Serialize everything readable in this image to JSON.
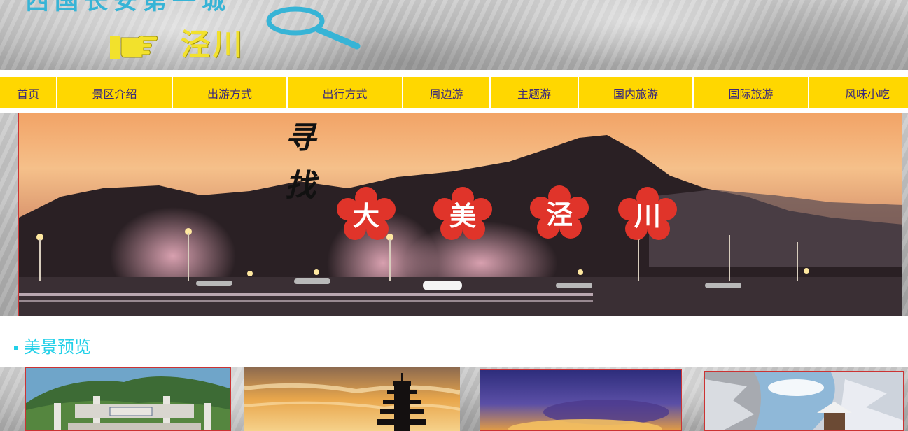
{
  "header": {
    "title": "西国长安第一城",
    "city": "泾川",
    "hand_icon": "pointing-hand-icon",
    "magnifier_icon": "magnifier-icon"
  },
  "nav": {
    "items": [
      {
        "label": "首页"
      },
      {
        "label": "景区介绍"
      },
      {
        "label": "出游方式"
      },
      {
        "label": "出行方式"
      },
      {
        "label": "周边游"
      },
      {
        "label": "主题游"
      },
      {
        "label": "国内旅游"
      },
      {
        "label": "国际旅游"
      },
      {
        "label": "风味小吃"
      }
    ]
  },
  "banner": {
    "vertical_words": [
      "寻",
      "找"
    ],
    "flower_words": [
      "大",
      "美",
      "泾",
      "川"
    ],
    "slide_count": 5,
    "active_slide": 3
  },
  "section": {
    "title": "美景预览"
  },
  "colors": {
    "nav_background": "#ffd700",
    "nav_text": "#3b2a7a",
    "section_title": "#22d0e8",
    "flower": "#e0342a",
    "header_title": "#37b4d6",
    "header_city": "#f2e12c"
  }
}
